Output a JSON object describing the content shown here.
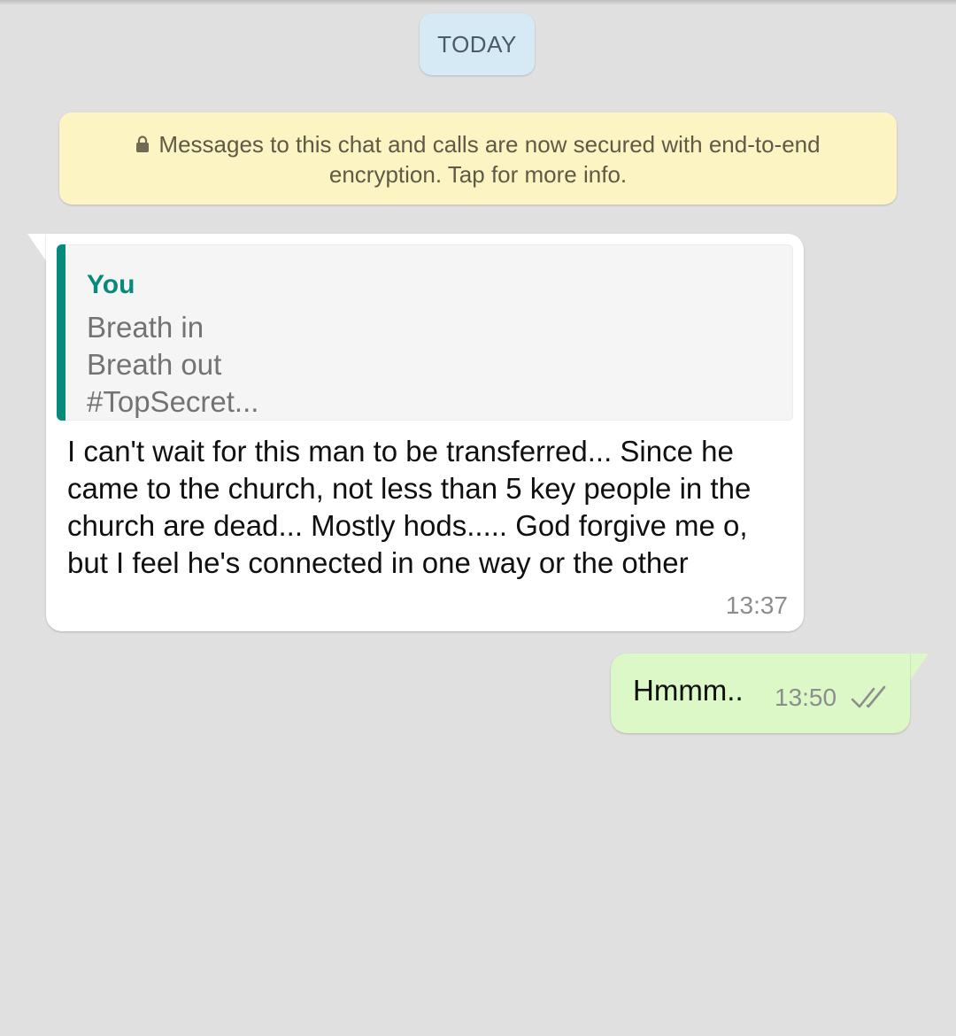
{
  "date_divider": {
    "label": "TODAY"
  },
  "encryption_notice": {
    "text": "Messages to this chat and calls are now secured with end-to-end encryption. Tap for more info.",
    "icon": "lock-icon"
  },
  "messages": [
    {
      "direction": "incoming",
      "quoted": {
        "author": "You",
        "text": "Breath in\nBreath out\n#TopSecret..."
      },
      "text": "I can't wait for this man to be transferred... Since he came to the church, not less than 5 key people in the church are dead... Mostly hods..... God forgive me o, but I feel he's connected in one way or the other",
      "time": "13:37"
    },
    {
      "direction": "outgoing",
      "text": "Hmmm..",
      "time": "13:50",
      "status_icon": "double-check-icon"
    }
  ],
  "colors": {
    "background": "#e0e0e0",
    "incoming_bubble": "#ffffff",
    "outgoing_bubble": "#dcf8c6",
    "notice_bg": "#fdf4c4",
    "date_chip_bg": "#d6eaf6",
    "accent_teal": "#07897b"
  }
}
